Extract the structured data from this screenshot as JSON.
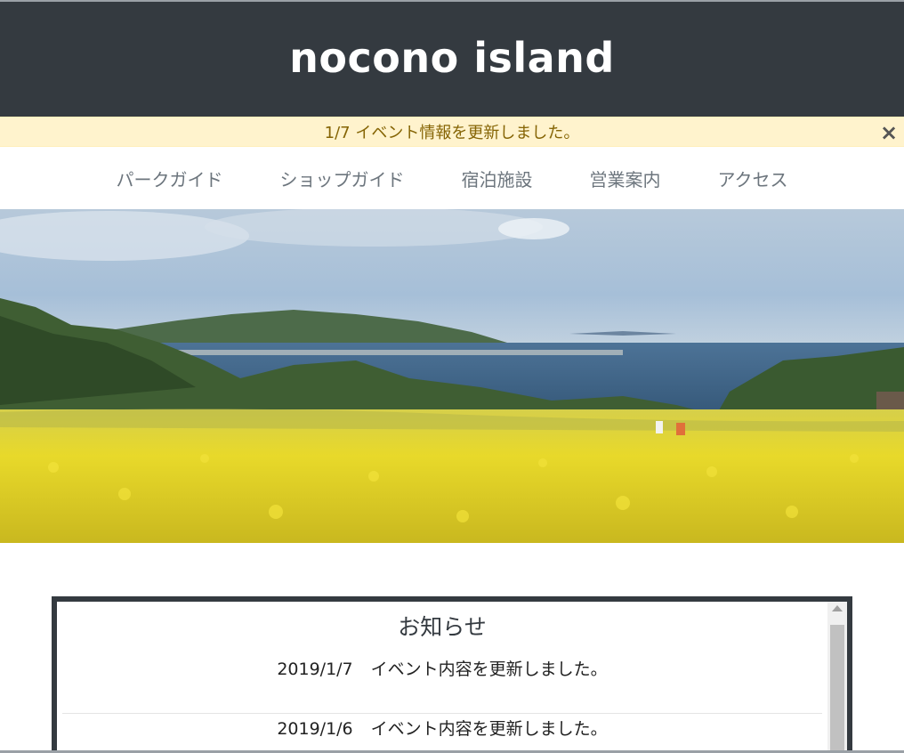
{
  "site": {
    "title": "nocono island"
  },
  "alert": {
    "message": "1/7 イベント情報を更新しました。",
    "close_label": "×"
  },
  "nav": {
    "items": [
      {
        "label": "パークガイド"
      },
      {
        "label": "ショップガイド"
      },
      {
        "label": "宿泊施設"
      },
      {
        "label": "営業案内"
      },
      {
        "label": "アクセス"
      }
    ]
  },
  "hero": {
    "description_icon": "landscape-image",
    "colors": {
      "sky": "#a9c3dc",
      "sea": "#3f6688",
      "flowers": "#e6d62a"
    }
  },
  "news": {
    "heading": "お知らせ",
    "items": [
      {
        "date": "2019/1/7",
        "text": "イベント内容を更新しました。"
      },
      {
        "date": "2019/1/6",
        "text": "イベント内容を更新しました。"
      }
    ]
  },
  "colors": {
    "header_bg": "#343a40",
    "alert_bg": "#fff3cd",
    "alert_text": "#856404",
    "nav_text": "#6c757d"
  }
}
